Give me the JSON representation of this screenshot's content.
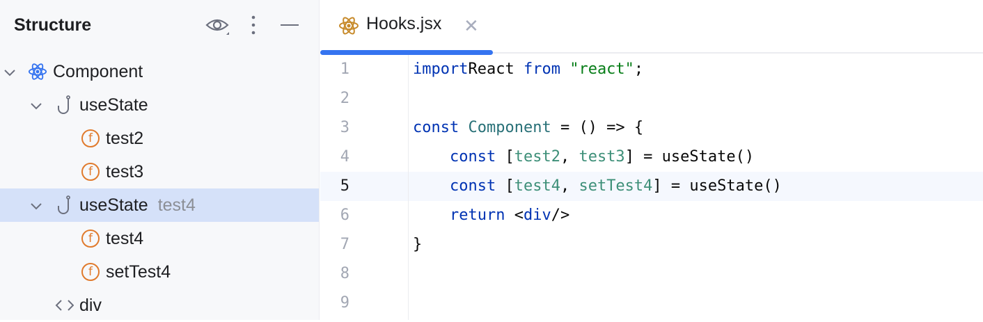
{
  "sidebar": {
    "title": "Structure",
    "tree": [
      {
        "label": "Component",
        "icon": "react-icon",
        "depth": 0,
        "expanded": true
      },
      {
        "label": "useState",
        "icon": "hook-icon",
        "depth": 1,
        "expanded": true
      },
      {
        "label": "test2",
        "icon": "function-icon",
        "depth": 2
      },
      {
        "label": "test3",
        "icon": "function-icon",
        "depth": 2
      },
      {
        "label": "useState",
        "hint": "test4",
        "icon": "hook-icon",
        "depth": 1,
        "expanded": true,
        "selected": true
      },
      {
        "label": "test4",
        "icon": "function-icon",
        "depth": 2
      },
      {
        "label": "setTest4",
        "icon": "function-icon",
        "depth": 2
      },
      {
        "label": "div",
        "icon": "tag-icon",
        "depth": 1
      }
    ]
  },
  "editor": {
    "tab": {
      "label": "Hooks.jsx"
    },
    "current_line": 5,
    "lines": [
      [
        [
          "kw",
          "import"
        ],
        [
          "",
          "React "
        ],
        [
          "kw",
          "from "
        ],
        [
          "str",
          "\"react\""
        ],
        [
          "",
          ";"
        ]
      ],
      [],
      [
        [
          "kw",
          "const "
        ],
        [
          "cls",
          "Component"
        ],
        [
          "",
          " = () => {"
        ]
      ],
      [
        [
          "",
          "    "
        ],
        [
          "kw",
          "const "
        ],
        [
          "",
          "["
        ],
        [
          "var",
          "test2"
        ],
        [
          "",
          ", "
        ],
        [
          "var",
          "test3"
        ],
        [
          "",
          "] = useState()"
        ]
      ],
      [
        [
          "",
          "    "
        ],
        [
          "kw",
          "const "
        ],
        [
          "",
          "["
        ],
        [
          "var",
          "test4"
        ],
        [
          "",
          ", "
        ],
        [
          "var",
          "setTest4"
        ],
        [
          "",
          "] = useState()"
        ]
      ],
      [
        [
          "",
          "    "
        ],
        [
          "kw",
          "return "
        ],
        [
          "",
          "<"
        ],
        [
          "tag",
          "div"
        ],
        [
          "",
          "/>"
        ]
      ],
      [
        [
          "",
          "}"
        ]
      ],
      [],
      []
    ]
  }
}
